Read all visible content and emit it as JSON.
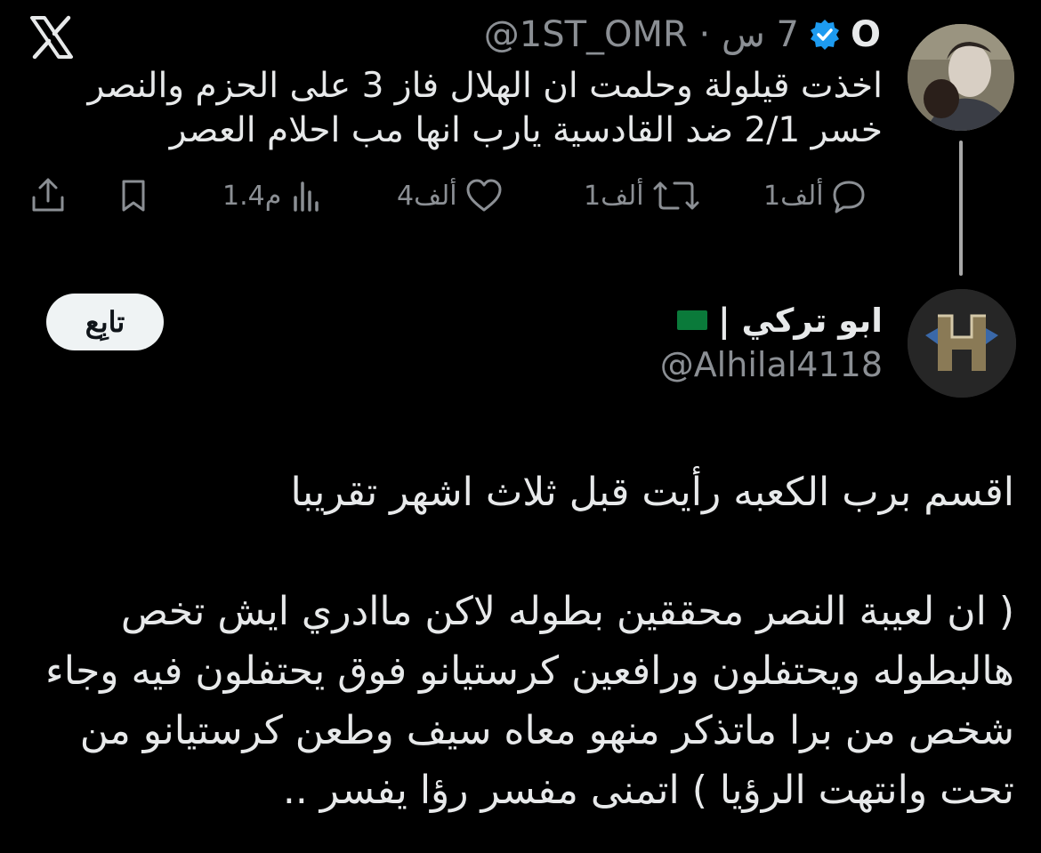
{
  "brand": {
    "logo_icon": "x-logo-icon"
  },
  "tweet1": {
    "display_name": "O",
    "handle": "@1ST_OMR",
    "separator": "·",
    "time": "7 س",
    "verified_icon": "verified-badge-icon",
    "text": "اخذت قيلولة وحلمت ان الهلال فاز 3 على الحزم والنصر خسر 2/1 ضد القادسية يارب انها مب احلام العصر",
    "actions": {
      "reply": {
        "icon": "reply-icon",
        "count": "1ألف"
      },
      "retweet": {
        "icon": "retweet-icon",
        "count": "1ألف"
      },
      "like": {
        "icon": "like-icon",
        "count": "4ألف"
      },
      "views": {
        "icon": "views-icon",
        "count": "1.4م"
      },
      "bookmark": {
        "icon": "bookmark-icon"
      },
      "share": {
        "icon": "share-icon"
      }
    }
  },
  "tweet2": {
    "display_name": "ابو تركي |",
    "flag_icon": "saudi-flag-icon",
    "handle": "@Alhilal4118",
    "follow_label": "تابِع",
    "paragraph1": "اقسم برب الكعبه رأيت قبل ثلاث اشهر تقريبا",
    "paragraph2": "( ان لعيبة النصر محققين بطوله لاكن ماادري ايش تخص هالبطوله ويحتفلون ورافعين كرستيانو فوق يحتفلون فيه وجاء شخص من برا ماتذكر منهو معاه سيف وطعن كرستيانو من تحت وانتهت الرؤيا ) اتمنى مفسر رؤا يفسر .."
  },
  "colors": {
    "background": "#000000",
    "text": "#e7e9ea",
    "muted": "#8b8f94",
    "verified": "#1d9bf0"
  }
}
